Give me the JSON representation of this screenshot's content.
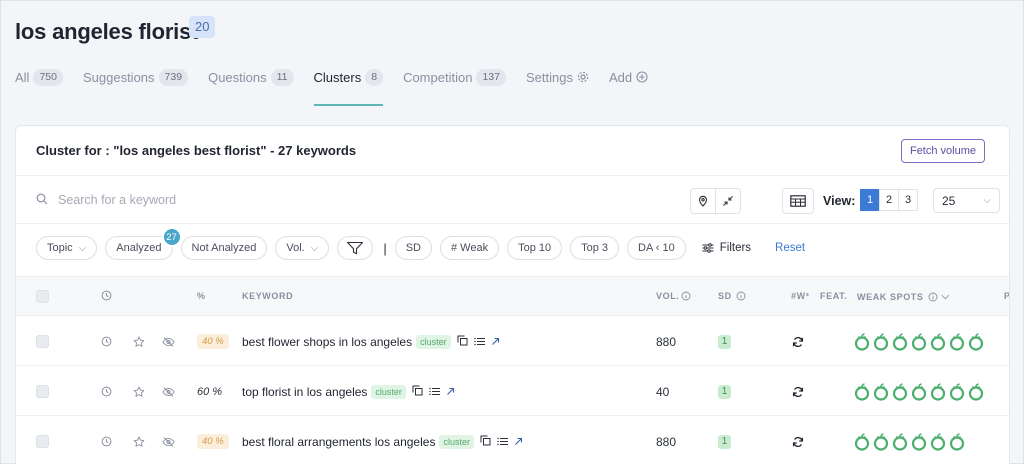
{
  "header": {
    "title": "los angeles florist",
    "count": "20"
  },
  "tabs": [
    {
      "label": "All",
      "count": "750"
    },
    {
      "label": "Suggestions",
      "count": "739"
    },
    {
      "label": "Questions",
      "count": "11"
    },
    {
      "label": "Clusters",
      "count": "8",
      "active": true
    },
    {
      "label": "Competition",
      "count": "137"
    },
    {
      "label": "Settings",
      "icon": "gear-icon"
    },
    {
      "label": "Add",
      "icon": "plus-circle-icon"
    }
  ],
  "card": {
    "title": "Cluster for : \"los angeles best florist\" - 27 keywords",
    "fetch_label": "Fetch volume"
  },
  "search": {
    "placeholder": "Search for a keyword",
    "value": ""
  },
  "view": {
    "label": "View:",
    "pages": [
      "1",
      "2",
      "3"
    ],
    "active_page": "1",
    "per_page": "25"
  },
  "filters": {
    "topic": "Topic",
    "analyzed": "Analyzed",
    "analyzed_count": "27",
    "not_analyzed": "Not Analyzed",
    "vol": "Vol.",
    "sd": "SD",
    "weak": "# Weak",
    "top10": "Top 10",
    "top3": "Top 3",
    "da": "DA ‹ 10",
    "filters_label": "Filters",
    "reset_label": "Reset"
  },
  "columns": {
    "pct": "%",
    "keyword": "KEYWORD",
    "vol": "VOL.",
    "sd": "SD",
    "w3": "#W³",
    "feat": "FEAT.",
    "weak_spots": "WEAK SPOTS",
    "pr": "P"
  },
  "rows": [
    {
      "pct": "40 %",
      "pct_style": "badge",
      "keyword": "best flower shops in los angeles",
      "tag": "cluster",
      "vol": "880",
      "sd": "1",
      "weak_spots": 7
    },
    {
      "pct": "60 %",
      "pct_style": "plain",
      "keyword": "top florist in los angeles",
      "tag": "cluster",
      "vol": "40",
      "sd": "1",
      "weak_spots": 7
    },
    {
      "pct": "40 %",
      "pct_style": "badge",
      "keyword": "best floral arrangements los angeles",
      "tag": "cluster",
      "vol": "880",
      "sd": "1",
      "weak_spots": 6
    }
  ],
  "colors": {
    "accent": "#3b7bd6",
    "tab_underline": "#5fb5b3",
    "weak_spot": "#4caf6e",
    "badge_teal": "#48a6c8"
  }
}
